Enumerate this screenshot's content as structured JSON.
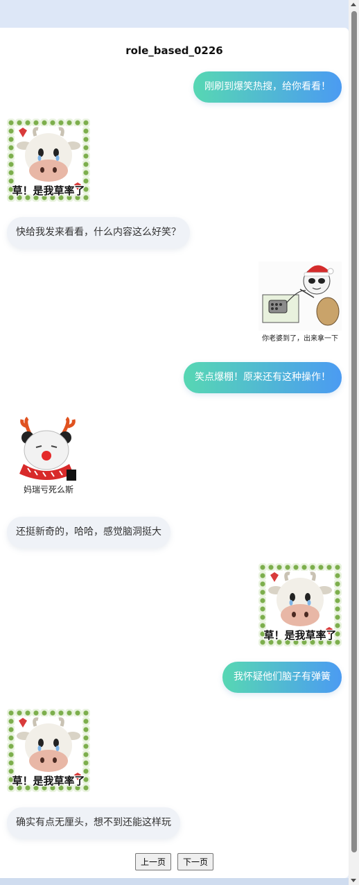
{
  "page": {
    "title": "role_based_0226"
  },
  "messages": [
    {
      "side": "right",
      "type": "text",
      "text": "刚刷到爆笑热搜，给你看看！"
    },
    {
      "side": "left",
      "type": "sticker",
      "sticker": "cow-crying",
      "caption": "草！是我草率了"
    },
    {
      "side": "left",
      "type": "text",
      "text": "快给我发来看看，什么内容这么好笑？"
    },
    {
      "side": "right",
      "type": "sticker",
      "sticker": "santa-panda",
      "caption": "你老婆到了，出来拿一下"
    },
    {
      "side": "right",
      "type": "text",
      "text": "笑点爆棚！原来还有这种操作！"
    },
    {
      "side": "left",
      "type": "sticker",
      "sticker": "reindeer-panda",
      "caption": "妈瑞亏死么斯"
    },
    {
      "side": "left",
      "type": "text",
      "text": "还挺新奇的，哈哈，感觉脑洞挺大"
    },
    {
      "side": "right",
      "type": "sticker",
      "sticker": "cow-crying",
      "caption": "草！是我草率了"
    },
    {
      "side": "right",
      "type": "text",
      "text": "我怀疑他们脑子有弹簧"
    },
    {
      "side": "left",
      "type": "sticker",
      "sticker": "cow-crying",
      "caption": "草！是我草率了"
    },
    {
      "side": "left",
      "type": "text",
      "text": "确实有点无厘头，想不到还能这样玩"
    }
  ],
  "pager": {
    "prev_label": "上一页",
    "next_label": "下一页"
  }
}
